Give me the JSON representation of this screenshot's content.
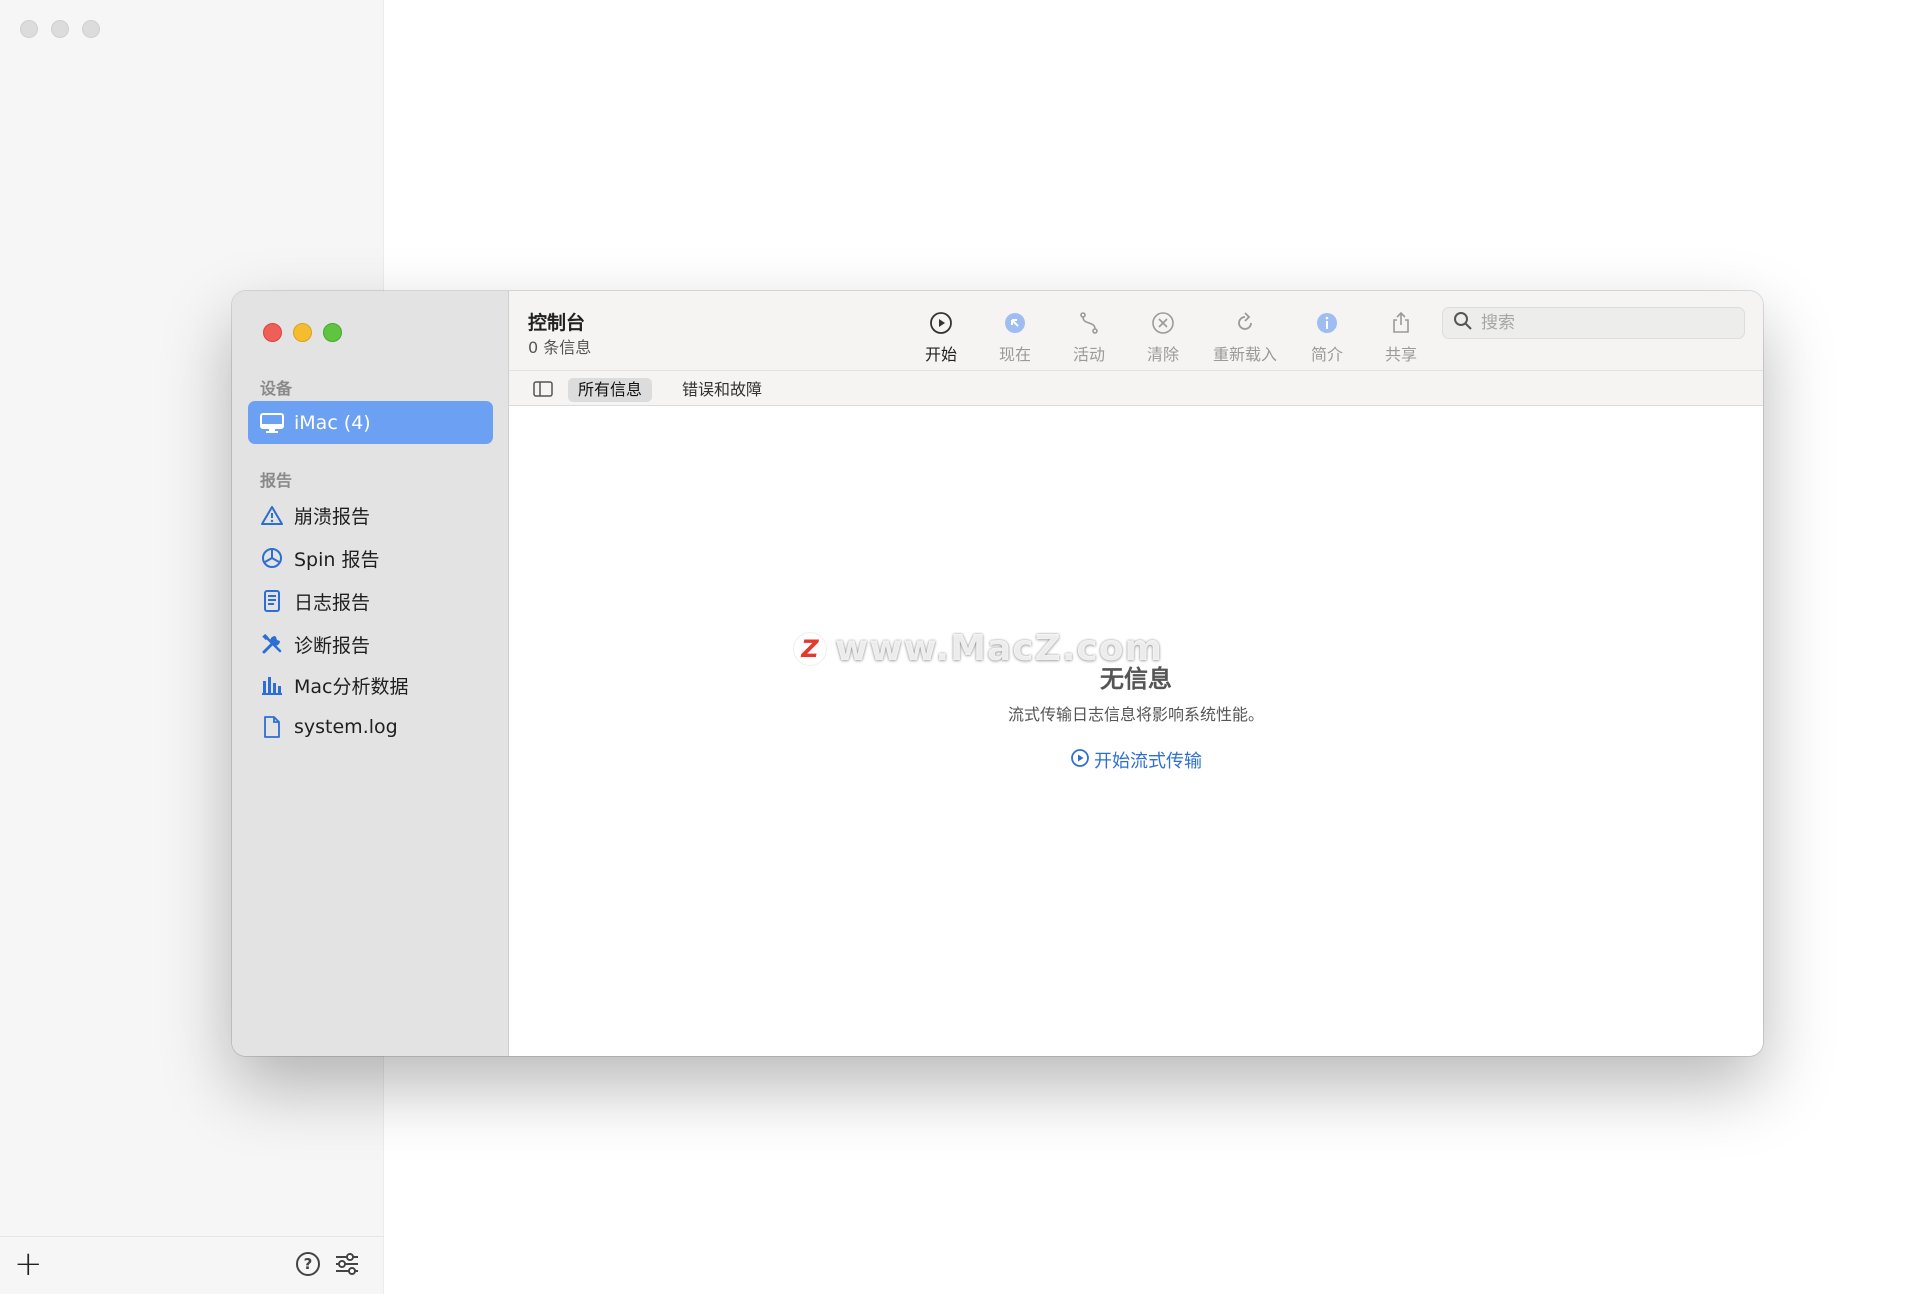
{
  "background_window": {
    "add_label": "+",
    "help_label": "?"
  },
  "window": {
    "title": "控制台",
    "subtitle": "0 条信息",
    "colors": {
      "selected_bg": "#6ba0f2",
      "link": "#2f6fd1",
      "close": "#ee5f57",
      "minimize": "#f4bd2f",
      "zoom": "#5fc43f"
    }
  },
  "sidebar": {
    "devices_header": "设备",
    "devices": [
      {
        "label": "iMac (4)",
        "icon": "imac-icon",
        "selected": true
      }
    ],
    "reports_header": "报告",
    "reports": [
      {
        "label": "崩溃报告",
        "icon": "warning-triangle-icon"
      },
      {
        "label": "Spin 报告",
        "icon": "spin-icon"
      },
      {
        "label": "日志报告",
        "icon": "document-icon"
      },
      {
        "label": "诊断报告",
        "icon": "tools-icon"
      },
      {
        "label": "Mac分析数据",
        "icon": "bar-chart-icon"
      },
      {
        "label": "system.log",
        "icon": "file-icon"
      }
    ]
  },
  "toolbar": {
    "buttons": [
      {
        "label": "开始",
        "icon": "play-icon",
        "enabled": true
      },
      {
        "label": "现在",
        "icon": "arrow-now-icon",
        "enabled": false
      },
      {
        "label": "活动",
        "icon": "activity-icon",
        "enabled": false
      },
      {
        "label": "清除",
        "icon": "clear-icon",
        "enabled": false
      },
      {
        "label": "重新载入",
        "icon": "reload-icon",
        "enabled": false
      },
      {
        "label": "简介",
        "icon": "info-icon",
        "enabled": false
      },
      {
        "label": "共享",
        "icon": "share-icon",
        "enabled": false
      }
    ],
    "search": {
      "placeholder": "搜索",
      "value": ""
    }
  },
  "filter": {
    "tabs": [
      {
        "label": "所有信息",
        "selected": true
      },
      {
        "label": "错误和故障",
        "selected": false
      }
    ]
  },
  "content": {
    "empty_title": "无信息",
    "empty_description": "流式传输日志信息将影响系统性能。",
    "start_link": "开始流式传输"
  },
  "watermark": {
    "logo": "Z",
    "text": "www.MacZ.com"
  }
}
